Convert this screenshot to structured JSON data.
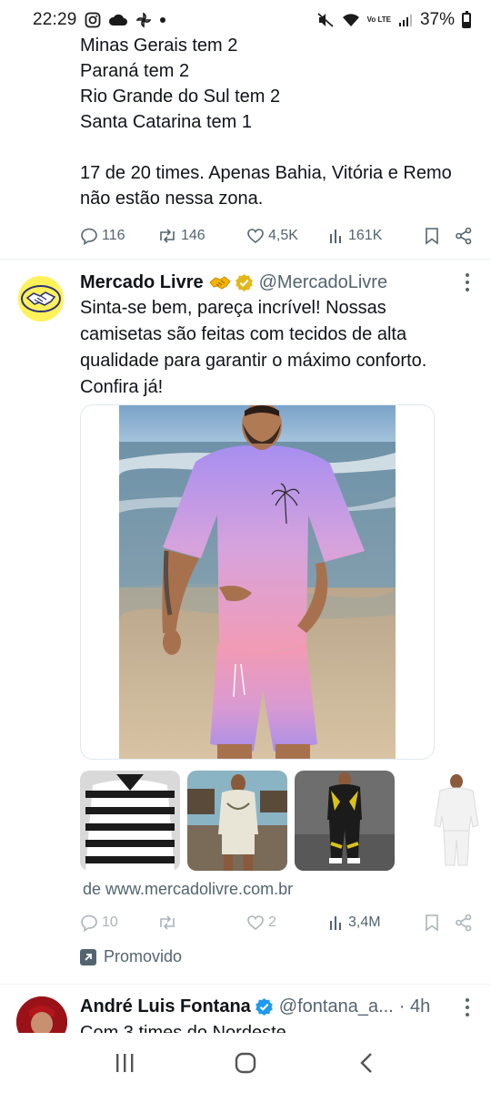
{
  "status_bar": {
    "time": "22:29",
    "battery": "37%",
    "network": "Vo LTE"
  },
  "tweet_prev": {
    "lines": [
      "Minas Gerais tem 2",
      "Paraná tem 2",
      "Rio Grande do Sul tem 2",
      "Santa Catarina tem 1",
      "17 de 20 times. Apenas Bahia, Vitória e Remo",
      "não estão nessa zona."
    ],
    "stats": {
      "replies": "116",
      "retweets": "146",
      "likes": "4,5K",
      "views": "161K"
    }
  },
  "tweet_ad": {
    "name": "Mercado Livre",
    "handle": "@MercadoLivre",
    "text": "Sinta-se bem, pareça incrível! Nossas camisetas são feitas com tecidos de alta qualidade para garantir o máximo conforto. Confira já!",
    "link": "de www.mercadolivre.com.br",
    "stats": {
      "replies": "10",
      "retweets": "",
      "likes": "2",
      "views": "3,4M"
    },
    "promoted_label": "Promovido"
  },
  "tweet_next": {
    "name": "André Luis Fontana",
    "handle": "@fontana_a...",
    "time": "· 4h",
    "text": "Com 3 times do Nordeste"
  },
  "colors": {
    "text_primary": "#0f1419",
    "text_secondary": "#536471",
    "verified_gold": "#e2b719",
    "verified_blue": "#1d9bf0",
    "mercado_yellow": "#fff159"
  }
}
